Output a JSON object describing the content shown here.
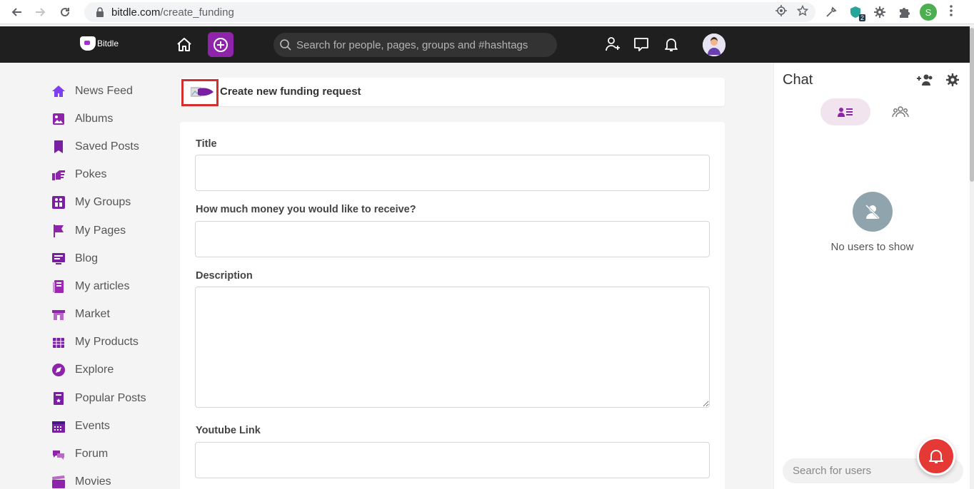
{
  "browser": {
    "url_domain": "bitdle.com",
    "url_path": "/create_funding",
    "profile_initial": "S",
    "extension_badge": "2"
  },
  "header": {
    "logo_text": "Bitdle",
    "search_placeholder": "Search for people, pages, groups and #hashtags"
  },
  "sidebar": {
    "items": [
      {
        "label": "News Feed",
        "icon": "home-icon",
        "color": "#7e3ff2"
      },
      {
        "label": "Albums",
        "icon": "albums-icon",
        "color": "#8e24aa"
      },
      {
        "label": "Saved Posts",
        "icon": "bookmark-icon",
        "color": "#7b1fa2"
      },
      {
        "label": "Pokes",
        "icon": "poke-hand-icon",
        "color": "#8e24aa"
      },
      {
        "label": "My Groups",
        "icon": "groups-icon",
        "color": "#7b1fa2"
      },
      {
        "label": "My Pages",
        "icon": "flag-icon",
        "color": "#8e24aa"
      },
      {
        "label": "Blog",
        "icon": "blog-icon",
        "color": "#7b1fa2"
      },
      {
        "label": "My articles",
        "icon": "articles-icon",
        "color": "#9c27b0"
      },
      {
        "label": "Market",
        "icon": "market-icon",
        "color": "#8e24aa"
      },
      {
        "label": "My Products",
        "icon": "products-icon",
        "color": "#7b1fa2"
      },
      {
        "label": "Explore",
        "icon": "explore-icon",
        "color": "#8e24aa"
      },
      {
        "label": "Popular Posts",
        "icon": "popular-icon",
        "color": "#7b1fa2"
      },
      {
        "label": "Events",
        "icon": "calendar-icon",
        "color": "#7b1fa2"
      },
      {
        "label": "Forum",
        "icon": "forum-icon",
        "color": "#8e24aa"
      },
      {
        "label": "Movies",
        "icon": "movies-icon",
        "color": "#8e24aa"
      }
    ]
  },
  "main": {
    "page_title": "Create new funding request",
    "fields": {
      "title_label": "Title",
      "title_value": "",
      "amount_label": "How much money you would like to receive?",
      "amount_value": "",
      "description_label": "Description",
      "description_value": "",
      "youtube_label": "Youtube Link",
      "youtube_value": ""
    }
  },
  "chat": {
    "title": "Chat",
    "empty_text": "No users to show",
    "search_placeholder": "Search for users"
  },
  "colors": {
    "brand": "#8e24aa",
    "header_bg": "#1f1f1f",
    "highlight_border": "#d32f2f",
    "notification": "#e53935"
  }
}
